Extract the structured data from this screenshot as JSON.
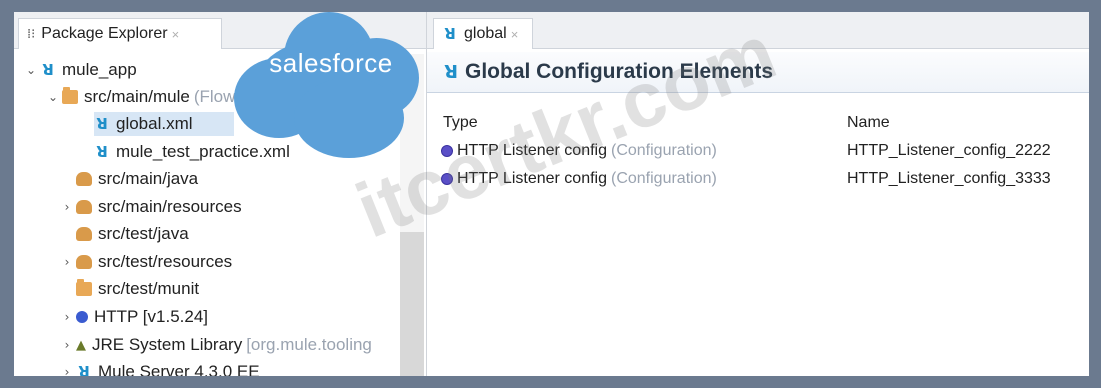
{
  "left_pane": {
    "tab_label": "Package Explorer",
    "tab_close": "×",
    "tree": [
      {
        "arrow": "⌄",
        "icon": "mule-icon",
        "label": "mule_app",
        "muted": ""
      },
      {
        "arrow": "⌄",
        "icon": "folder-icon",
        "label": "src/main/mule",
        "muted": "(Flows)"
      },
      {
        "arrow": "",
        "icon": "mule-icon",
        "label": "global.xml",
        "muted": "",
        "selected": true
      },
      {
        "arrow": "",
        "icon": "mule-icon",
        "label": "mule_test_practice.xml",
        "muted": ""
      },
      {
        "arrow": "",
        "icon": "package-folder-icon",
        "label": "src/main/java",
        "muted": ""
      },
      {
        "arrow": "›",
        "icon": "package-folder-icon",
        "label": "src/main/resources",
        "muted": ""
      },
      {
        "arrow": "",
        "icon": "package-folder-icon",
        "label": "src/test/java",
        "muted": ""
      },
      {
        "arrow": "›",
        "icon": "package-folder-icon",
        "label": "src/test/resources",
        "muted": ""
      },
      {
        "arrow": "",
        "icon": "folder-icon",
        "label": "src/test/munit",
        "muted": ""
      },
      {
        "arrow": "›",
        "icon": "http-icon",
        "label": "HTTP [v1.5.24]",
        "muted": ""
      },
      {
        "arrow": "›",
        "icon": "jre-library-icon",
        "label": "JRE System Library",
        "muted": "[org.mule.tooling"
      },
      {
        "arrow": "›",
        "icon": "mule-icon",
        "label": "Mule Server 4.3.0 EE",
        "muted": ""
      }
    ]
  },
  "brand": {
    "text": "salesforce",
    "color": "#5ba0d9"
  },
  "right_pane": {
    "tab_label": "global",
    "tab_close": "×",
    "title": "Global Configuration Elements",
    "columns": {
      "type": "Type",
      "name": "Name"
    },
    "rows": [
      {
        "type": "HTTP Listener config",
        "kind": "(Configuration)",
        "name": "HTTP_Listener_config_2222"
      },
      {
        "type": "HTTP Listener config",
        "kind": "(Configuration)",
        "name": "HTTP_Listener_config_3333"
      }
    ]
  },
  "watermark": "itcertkr.com"
}
